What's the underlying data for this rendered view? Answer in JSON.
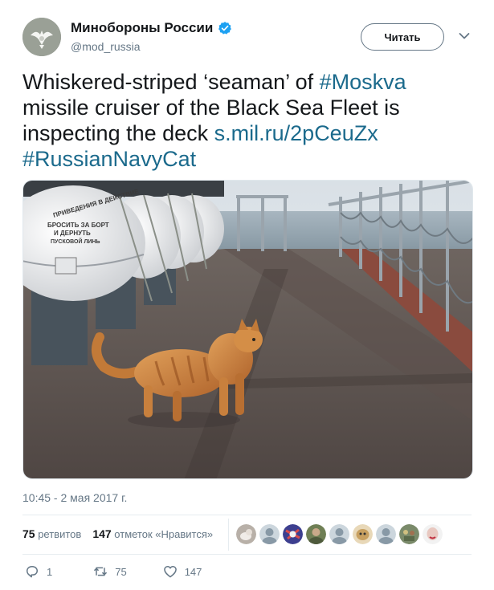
{
  "user": {
    "name": "Минобороны России",
    "handle": "@mod_russia"
  },
  "follow_label": "Читать",
  "tweet": {
    "line1_text": "Whiskered-striped ‘seaman’ of ",
    "hashtag1": "#Moskva",
    "line2_text": "missile cruiser of the Black Sea Fleet is",
    "line3_text": "inspecting the deck ",
    "link": "s.mil.ru/2pCeuZx",
    "hashtag2": "#RussianNavyCat"
  },
  "photo": {
    "raft_text_1": "ПРИВЕДЕНИЯ В ДЕЙСТВИЕ",
    "raft_text_2": "БРОСИТЬ ЗА БОРТ",
    "raft_text_3": "И ДЕРНУТЬ",
    "raft_text_4": "ПУСКОВОЙ ЛИНЬ"
  },
  "timestamp": "10:45 - 2 мая 2017 г.",
  "stats": {
    "retweets_count": "75",
    "retweets_label": "ретвитов",
    "likes_count": "147",
    "likes_label": "отметок «Нравится»"
  },
  "actions": {
    "replies": "1",
    "retweets": "75",
    "likes": "147"
  },
  "colors": {
    "link": "#1b6a8c",
    "verified": "#1da1f2",
    "secondary_text": "#657786"
  }
}
